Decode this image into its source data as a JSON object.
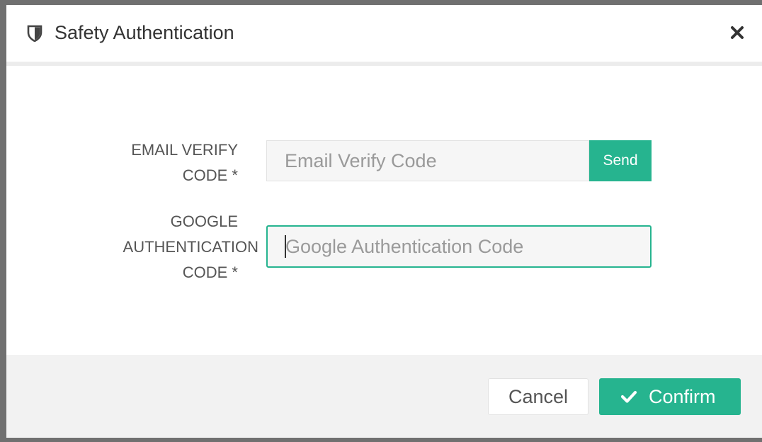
{
  "modal": {
    "title": "Safety Authentication",
    "header_icon": "shield-icon",
    "close_icon": "close-icon"
  },
  "form": {
    "email": {
      "label_line1": "EMAIL VERIFY",
      "label_line2": "CODE *",
      "placeholder": "Email Verify Code",
      "value": "",
      "send_label": "Send"
    },
    "google": {
      "label_line1": "GOOGLE",
      "label_line2": "AUTHENTICATION",
      "label_line3": "CODE *",
      "placeholder": "Google Authentication Code",
      "value": ""
    }
  },
  "footer": {
    "cancel_label": "Cancel",
    "confirm_label": "Confirm",
    "confirm_icon": "check-icon"
  },
  "colors": {
    "accent": "#26b48f",
    "footer_bg": "#f2f2f2",
    "backdrop": "#707070"
  }
}
